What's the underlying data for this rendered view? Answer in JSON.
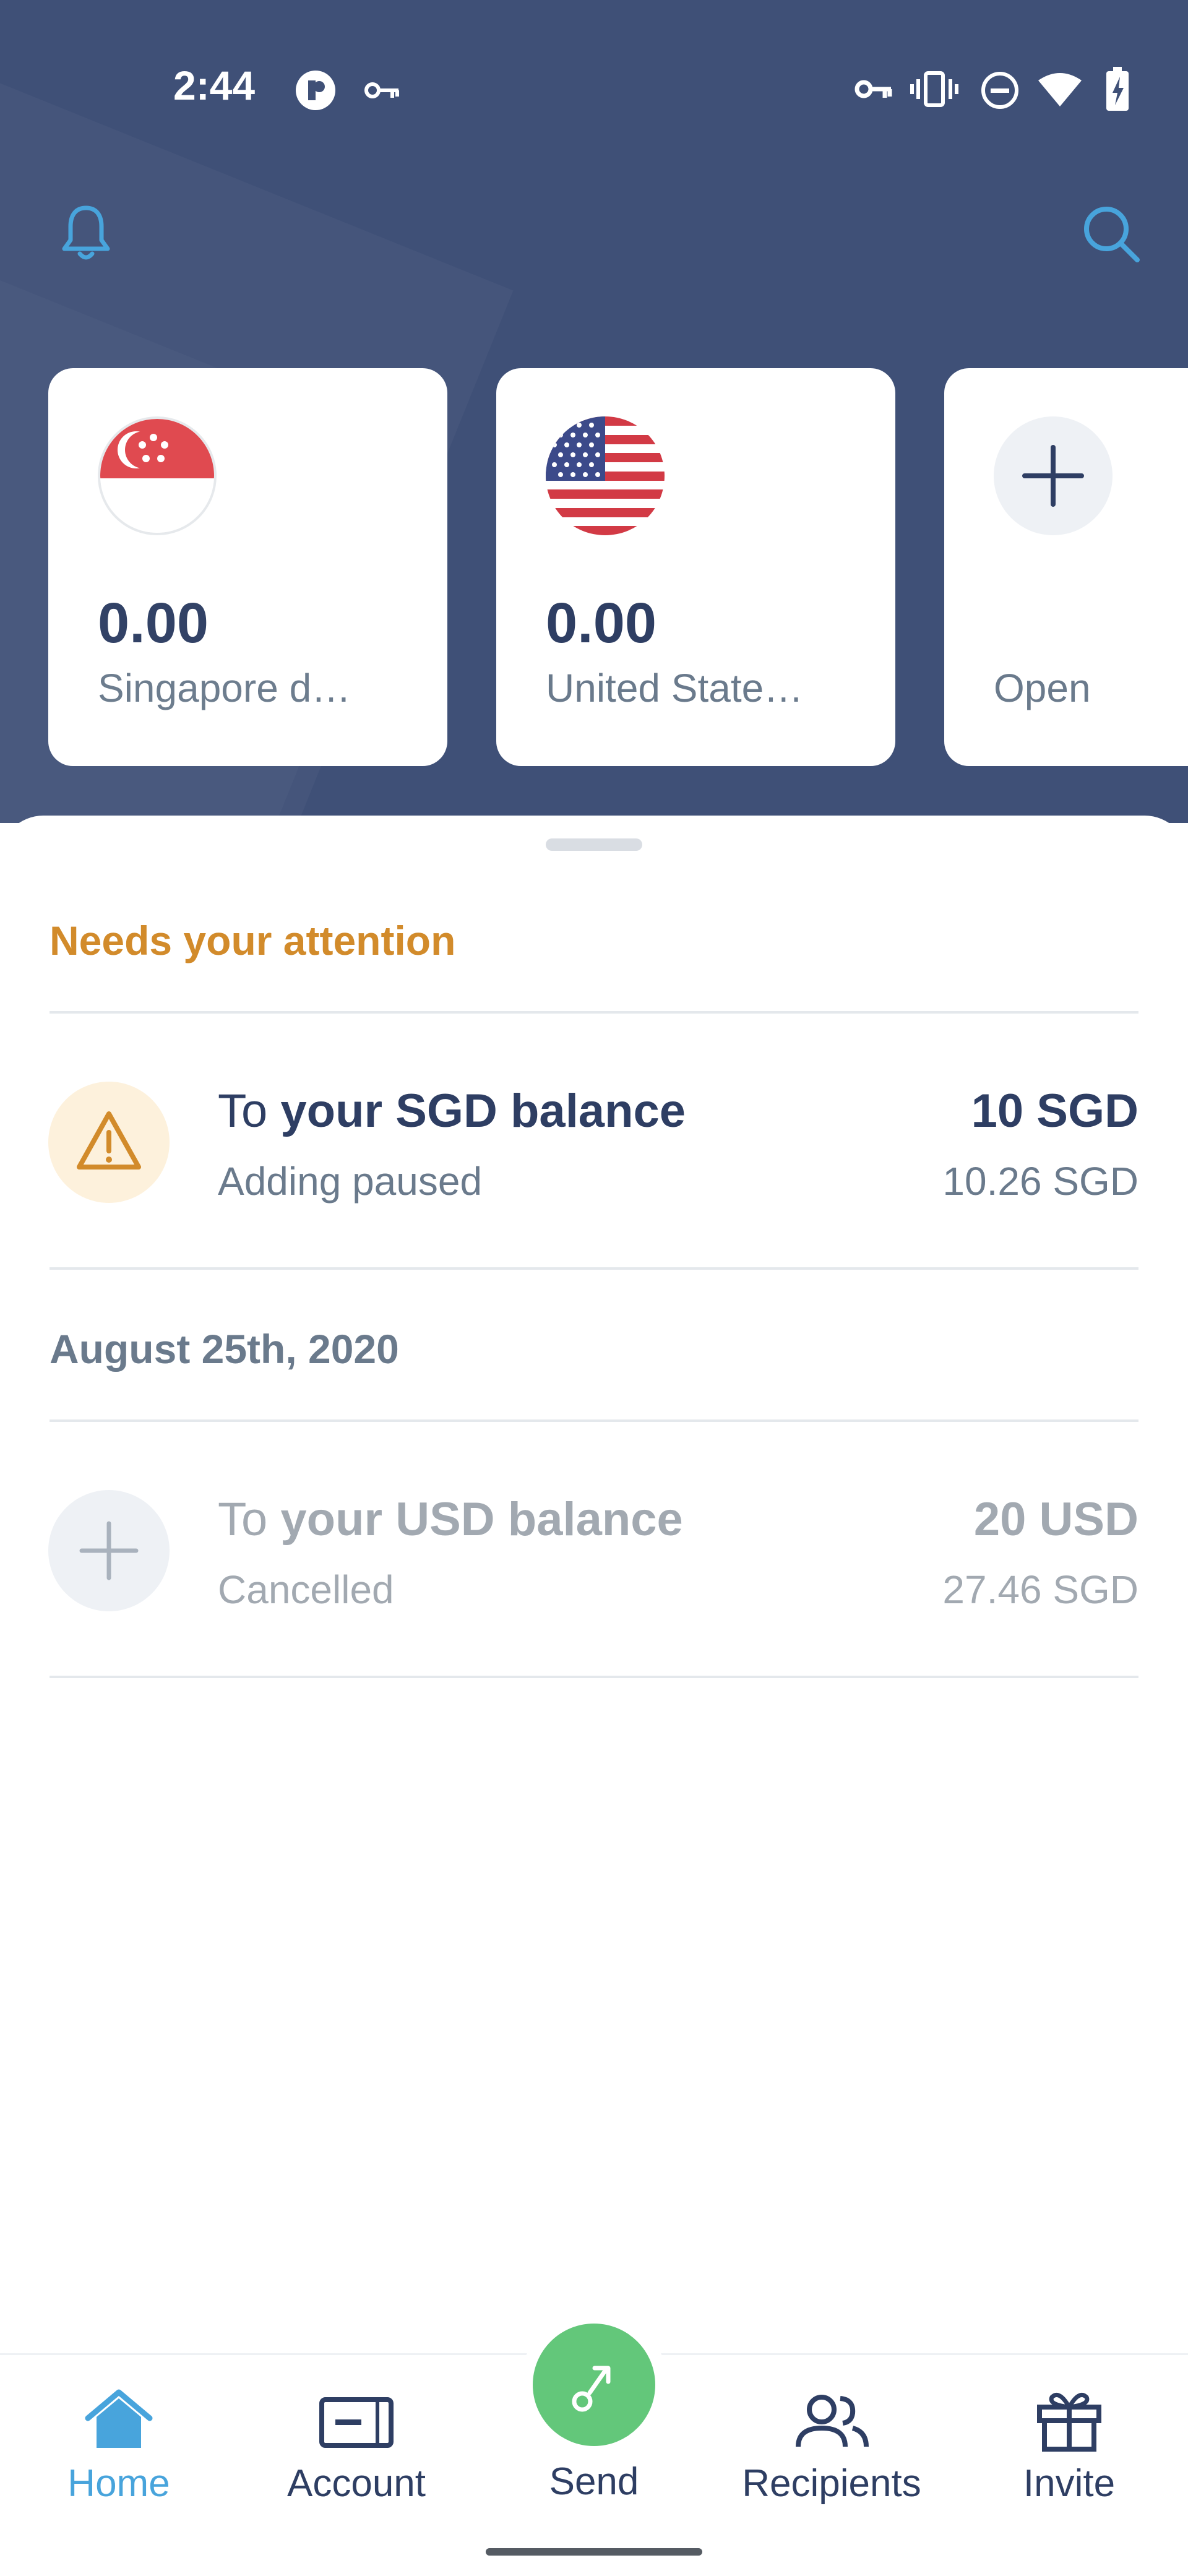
{
  "status_bar": {
    "time": "2:44",
    "icons": [
      "app-notification-icon",
      "vpn-key-icon",
      "key-icon",
      "vibrate-icon",
      "do-not-disturb-icon",
      "wifi-icon",
      "battery-charging-icon"
    ]
  },
  "header": {
    "icons": [
      "bell-icon",
      "search-icon"
    ]
  },
  "balances": [
    {
      "amount": "0.00",
      "currency": "Singapore d…",
      "flag": "singapore-flag"
    },
    {
      "amount": "0.00",
      "currency": "United State…",
      "flag": "us-flag"
    },
    {
      "label": "Open",
      "icon": "plus-icon"
    }
  ],
  "attention": {
    "title": "Needs your attention",
    "item": {
      "prefix": "To ",
      "title": "your SGD balance",
      "status": "Adding paused",
      "amount": "10 SGD",
      "converted": "10.26 SGD",
      "icon": "warning-icon"
    }
  },
  "history": {
    "date": "August 25th, 2020",
    "item": {
      "prefix": "To ",
      "title": "your USD balance",
      "status": "Cancelled",
      "amount": "20 USD",
      "converted": "27.46 SGD",
      "icon": "plus-icon"
    }
  },
  "nav": {
    "items": [
      {
        "label": "Home",
        "icon": "home-icon",
        "active": true
      },
      {
        "label": "Account",
        "icon": "card-icon"
      },
      {
        "label": "Send",
        "icon": "send-icon"
      },
      {
        "label": "Recipients",
        "icon": "people-icon"
      },
      {
        "label": "Invite",
        "icon": "gift-icon"
      }
    ]
  },
  "colors": {
    "header_bg": "#3f5077",
    "accent_blue": "#48a4dc",
    "attention_orange": "#d28b2b",
    "send_green": "#63c77a",
    "text_dark": "#2e3e63",
    "text_muted": "#6a7a8c"
  }
}
